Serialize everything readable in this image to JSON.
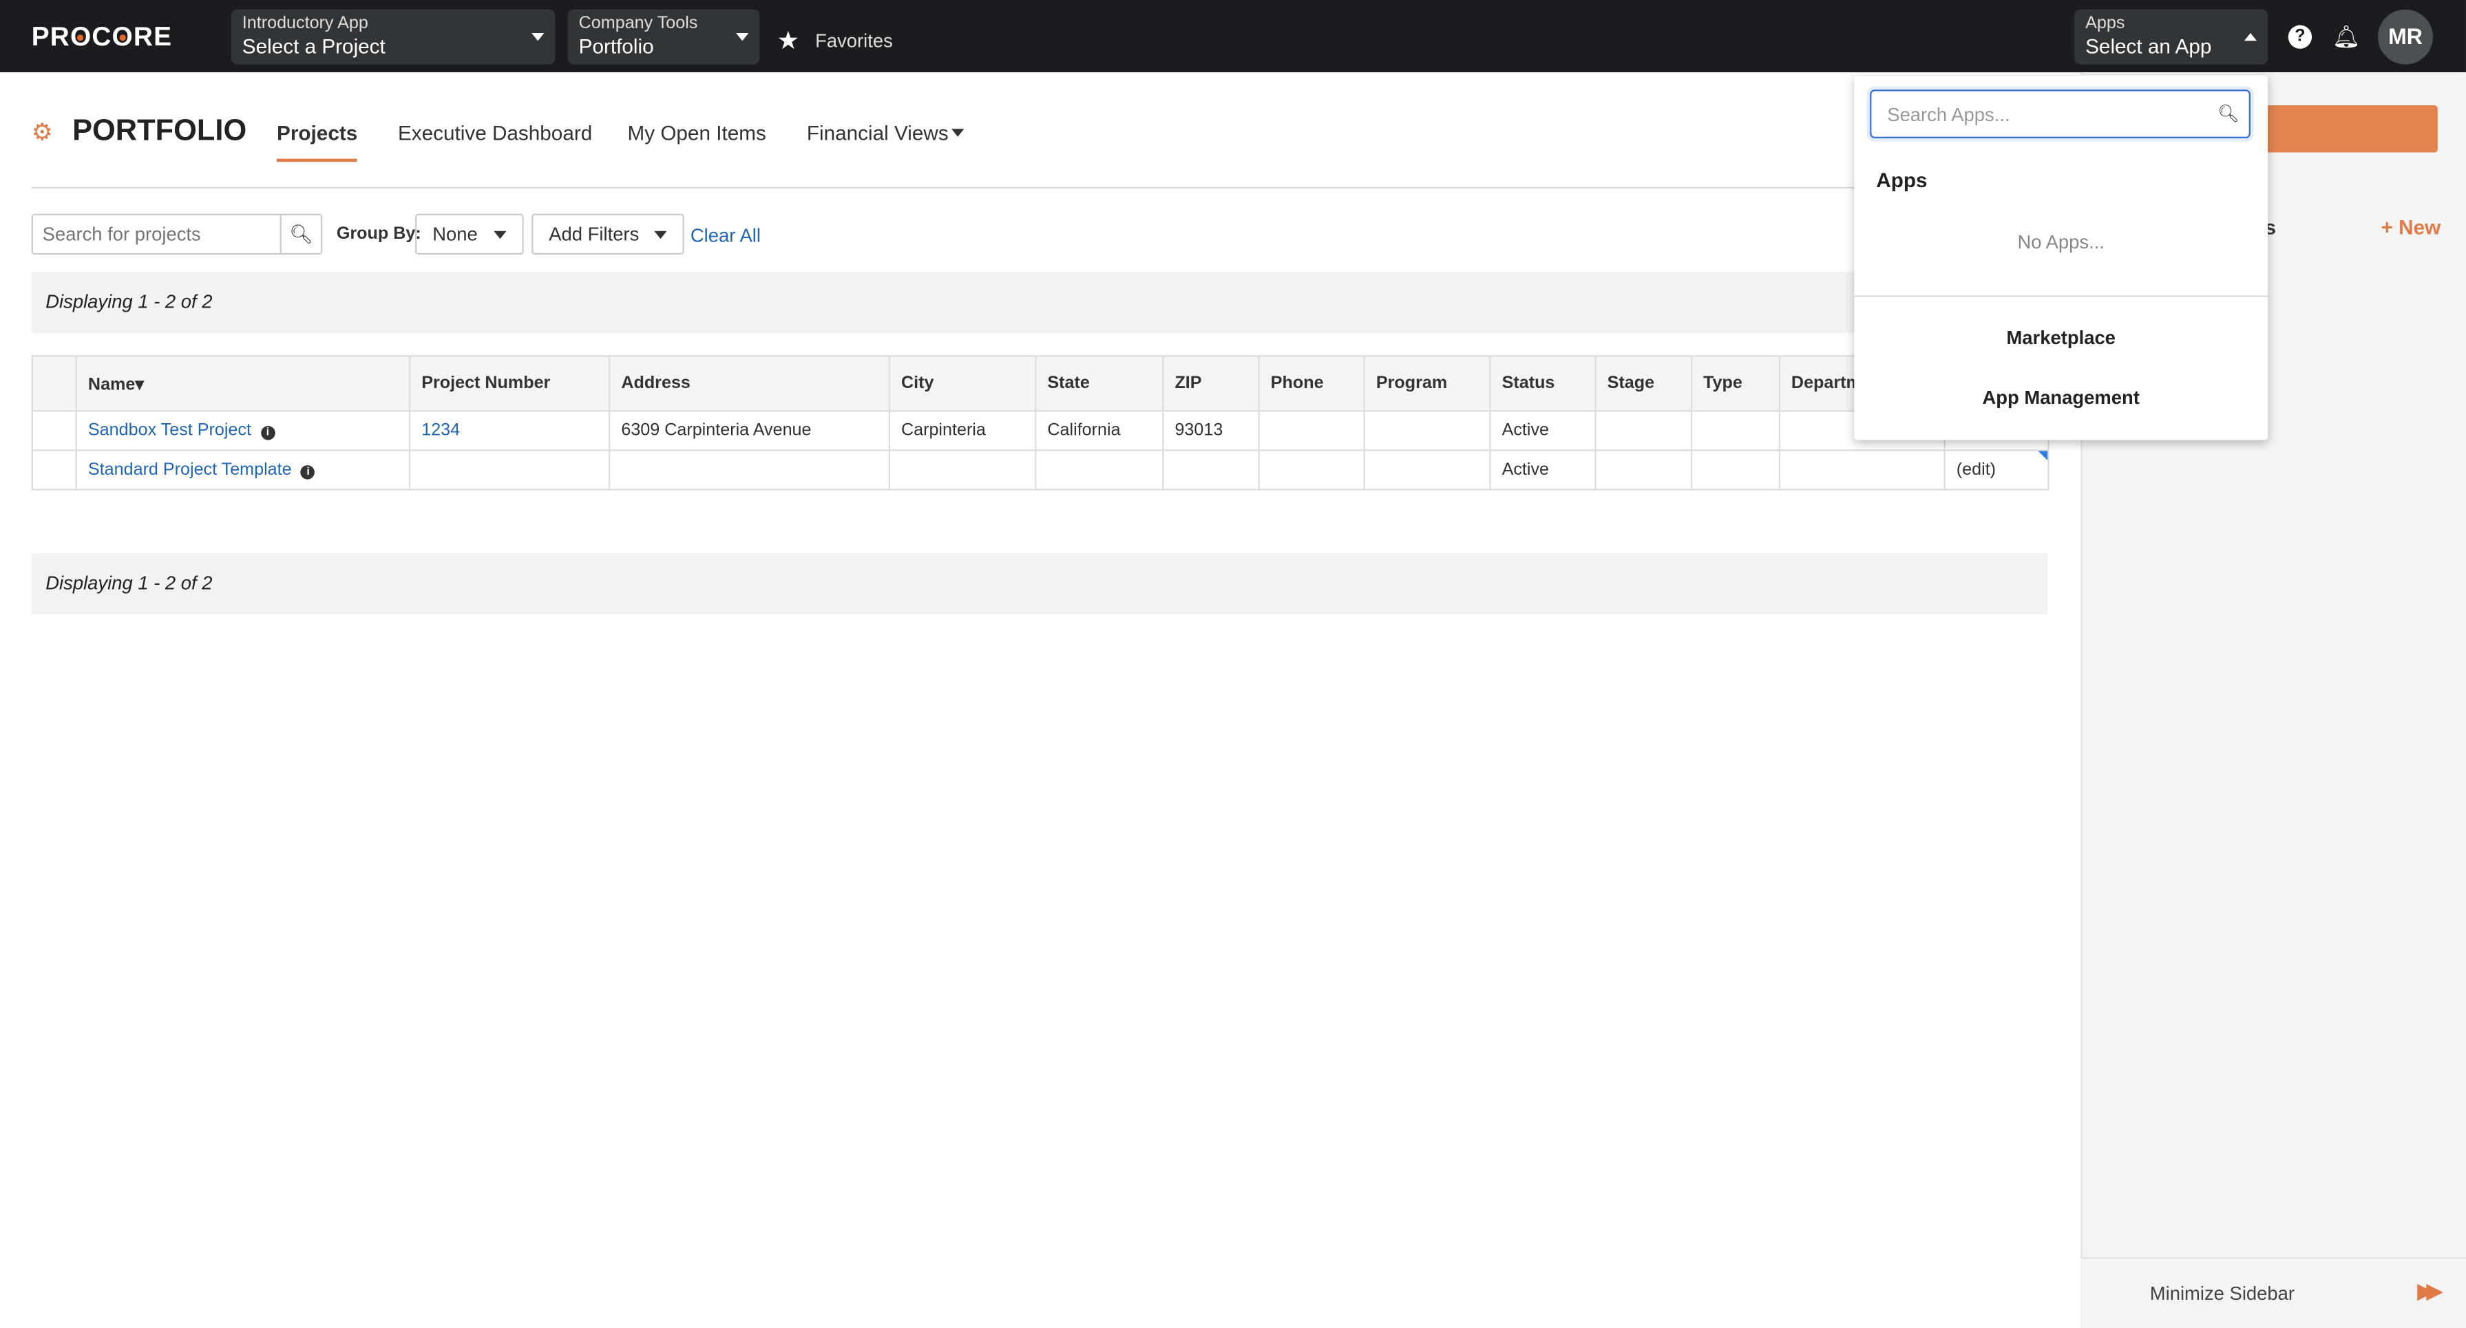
{
  "topbar": {
    "logo": "PROCORE",
    "project_selector": {
      "label": "Introductory App",
      "value": "Select a Project"
    },
    "tool_selector": {
      "label": "Company Tools",
      "value": "Portfolio"
    },
    "favorites": "Favorites",
    "apps_selector": {
      "label": "Apps",
      "value": "Select an App"
    },
    "help": "?",
    "avatar": "MR"
  },
  "page": {
    "title": "PORTFOLIO",
    "tabs": [
      {
        "label": "Projects",
        "active": true
      },
      {
        "label": "Executive Dashboard"
      },
      {
        "label": "My Open Items"
      },
      {
        "label": "Financial Views"
      }
    ]
  },
  "filters": {
    "search_placeholder": "Search for projects",
    "group_by_label": "Group By:",
    "group_by_value": "None",
    "add_filters": "Add Filters",
    "clear_all": "Clear All"
  },
  "display_text": "Displaying 1 - 2 of 2",
  "table": {
    "columns": [
      "Name▾",
      "Project Number",
      "Address",
      "City",
      "State",
      "ZIP",
      "Phone",
      "Program",
      "Status",
      "Stage",
      "Type",
      "Departm",
      ""
    ],
    "rows": [
      [
        "Sandbox Test Project",
        "1234",
        "6309 Carpinteria Avenue",
        "Carpinteria",
        "California",
        "93013",
        "",
        "",
        "Active",
        "",
        "",
        "",
        ""
      ],
      [
        "Standard Project Template",
        "",
        "",
        "",
        "",
        "",
        "",
        "",
        "Active",
        "",
        "",
        "",
        "(edit)"
      ]
    ]
  },
  "sidebar": {
    "heading_fragment": "s",
    "new": "+ New",
    "minimize": "Minimize Sidebar"
  },
  "apps_dropdown": {
    "search_placeholder": "Search Apps...",
    "heading": "Apps",
    "empty": "No Apps...",
    "links": [
      "Marketplace",
      "App Management"
    ]
  },
  "colors": {
    "brand_orange": "#e07a47",
    "link_blue": "#2066b6",
    "topbar": "#1b1c1f"
  }
}
